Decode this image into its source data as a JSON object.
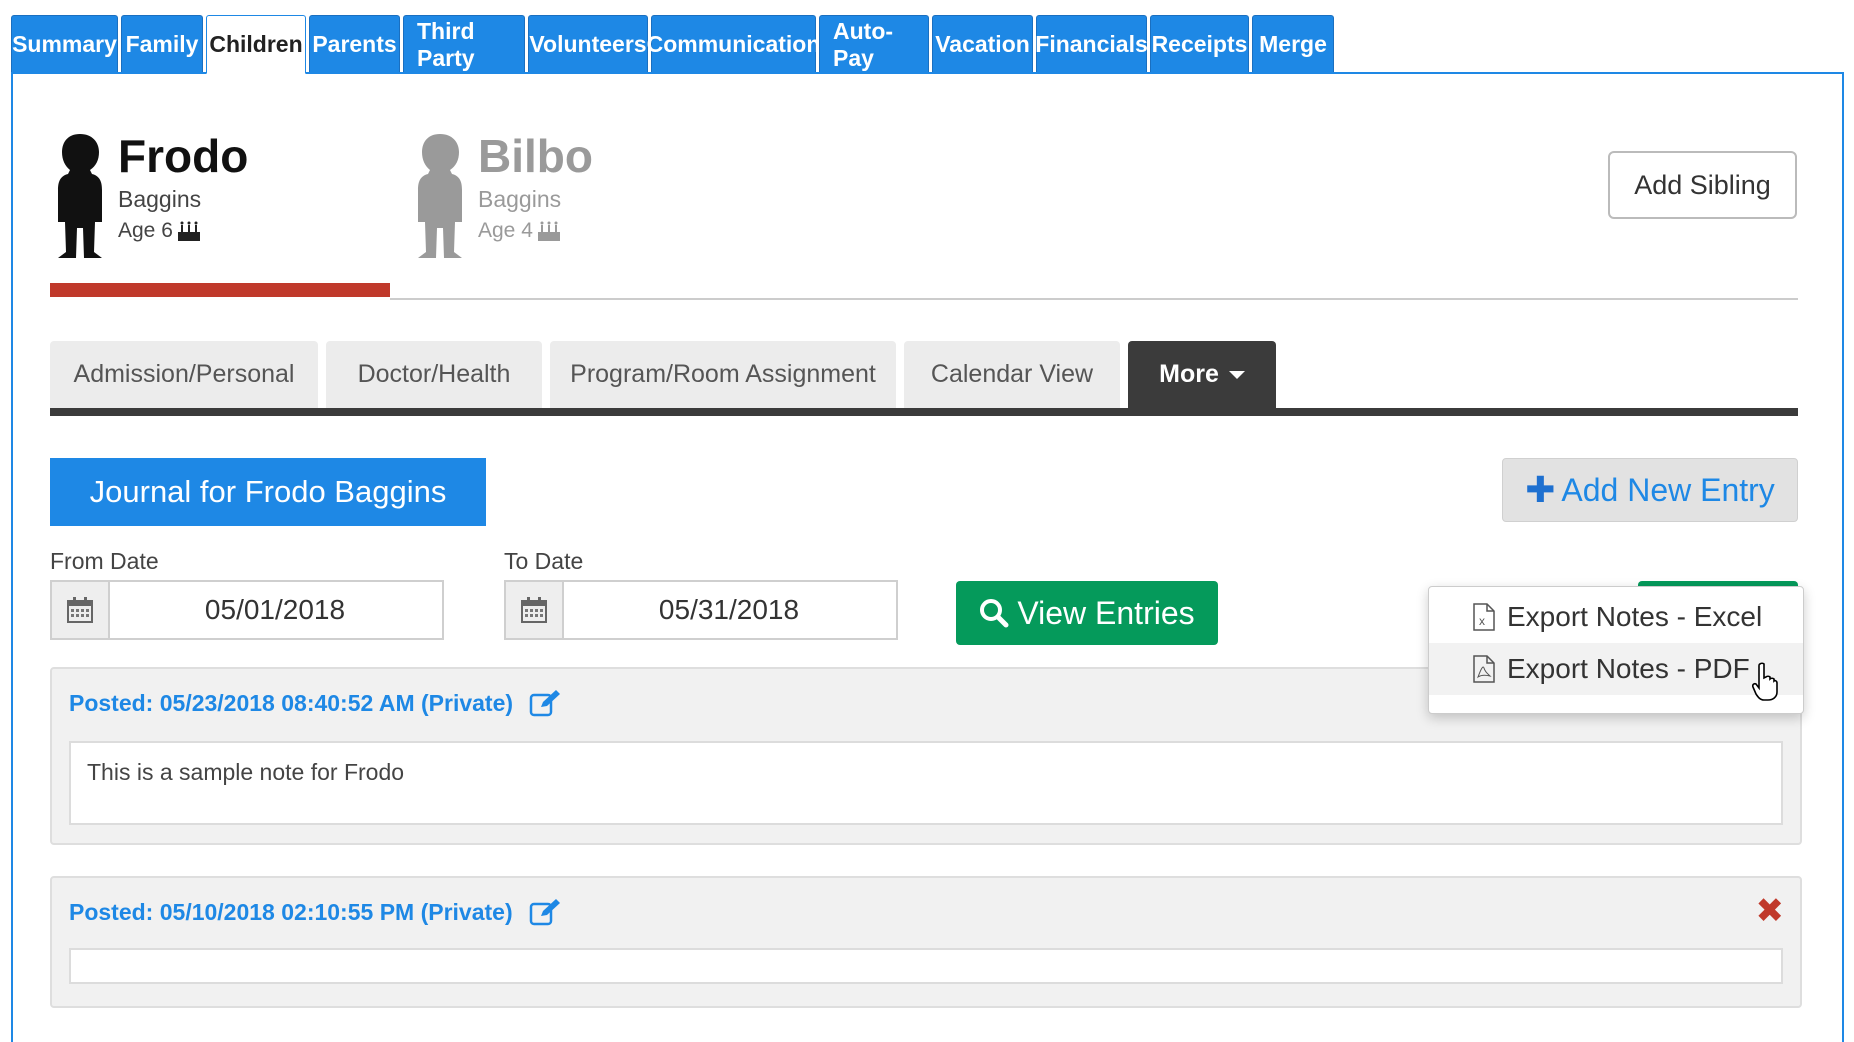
{
  "top_tabs": [
    {
      "label": "Summary",
      "active": false
    },
    {
      "label": "Family",
      "active": false
    },
    {
      "label": "Children",
      "active": true
    },
    {
      "label": "Parents",
      "active": false
    },
    {
      "label": "Third Party",
      "active": false
    },
    {
      "label": "Volunteers",
      "active": false
    },
    {
      "label": "Communication",
      "active": false
    },
    {
      "label": "Auto-Pay",
      "active": false
    },
    {
      "label": "Vacation",
      "active": false
    },
    {
      "label": "Financials",
      "active": false
    },
    {
      "label": "Receipts",
      "active": false
    },
    {
      "label": "Merge",
      "active": false
    }
  ],
  "children": [
    {
      "first": "Frodo",
      "last": "Baggins",
      "age": "Age 6",
      "selected": true
    },
    {
      "first": "Bilbo",
      "last": "Baggins",
      "age": "Age 4",
      "selected": false
    }
  ],
  "add_sibling_label": "Add Sibling",
  "sub_tabs": [
    {
      "label": "Admission/Personal"
    },
    {
      "label": "Doctor/Health"
    },
    {
      "label": "Program/Room Assignment"
    },
    {
      "label": "Calendar View"
    },
    {
      "label": "More"
    }
  ],
  "journal": {
    "title": "Journal for Frodo Baggins",
    "add_entry_label": "Add New Entry",
    "from_label": "From Date",
    "from_value": "05/01/2018",
    "to_label": "To Date",
    "to_value": "05/31/2018",
    "view_entries_label": "View Entries"
  },
  "export_menu": [
    {
      "label": "Export Notes - Excel",
      "icon": "excel-file-icon"
    },
    {
      "label": "Export Notes - PDF",
      "icon": "pdf-file-icon"
    }
  ],
  "notes": [
    {
      "posted": "Posted: 05/23/2018 08:40:52 AM (Private)",
      "body": "This is a sample note for Frodo",
      "deletable": false
    },
    {
      "posted": "Posted: 05/10/2018 02:10:55 PM (Private)",
      "body": "",
      "deletable": true
    }
  ],
  "colors": {
    "primary_blue": "#1e88e5",
    "green": "#059a5b",
    "red": "#c0392b",
    "dark_tab": "#3b3b3b"
  }
}
